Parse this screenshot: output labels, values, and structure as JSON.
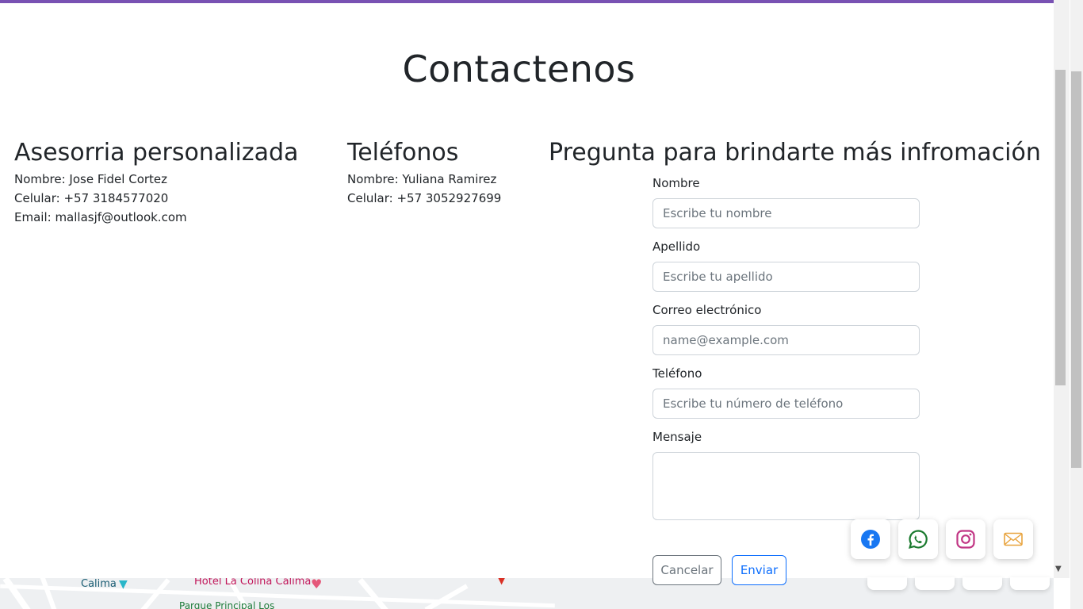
{
  "page": {
    "title": "Contactenos"
  },
  "columns": {
    "asesoria": {
      "heading": "Asesorria personalizada",
      "name": "Nombre: Jose Fidel Cortez",
      "phone": "Celular: +57 3184577020",
      "email": "Email: mallasjf@outlook.com"
    },
    "telefonos": {
      "heading": "Teléfonos",
      "name": "Nombre: Yuliana Ramirez",
      "phone": "Celular: +57 3052927699"
    },
    "pregunta": {
      "heading": "Pregunta para brindarte más infromación"
    }
  },
  "form": {
    "nombre": {
      "label": "Nombre",
      "placeholder": "Escribe tu nombre"
    },
    "apellido": {
      "label": "Apellido",
      "placeholder": "Escribe tu apellido"
    },
    "correo": {
      "label": "Correo electrónico",
      "placeholder": "name@example.com"
    },
    "telefono": {
      "label": "Teléfono",
      "placeholder": "Escribe tu número de teléfono"
    },
    "mensaje": {
      "label": "Mensaje",
      "placeholder": ""
    },
    "cancel_label": "Cancelar",
    "send_label": "Enviar"
  },
  "map": {
    "labels": [
      "Calima",
      "Hotel La Colina Calima",
      "Parque Principal Los"
    ]
  },
  "social": {
    "icons": [
      "facebook-icon",
      "whatsapp-icon",
      "instagram-icon",
      "mail-icon"
    ],
    "colors": {
      "facebook": "#1877f2",
      "whatsapp": "#1a7a2e",
      "instagram": "#c13584",
      "mail": "#e8a33d"
    }
  },
  "colors": {
    "accent": "#7952b3",
    "primary": "#0d6efd",
    "secondary": "#6c757d"
  }
}
